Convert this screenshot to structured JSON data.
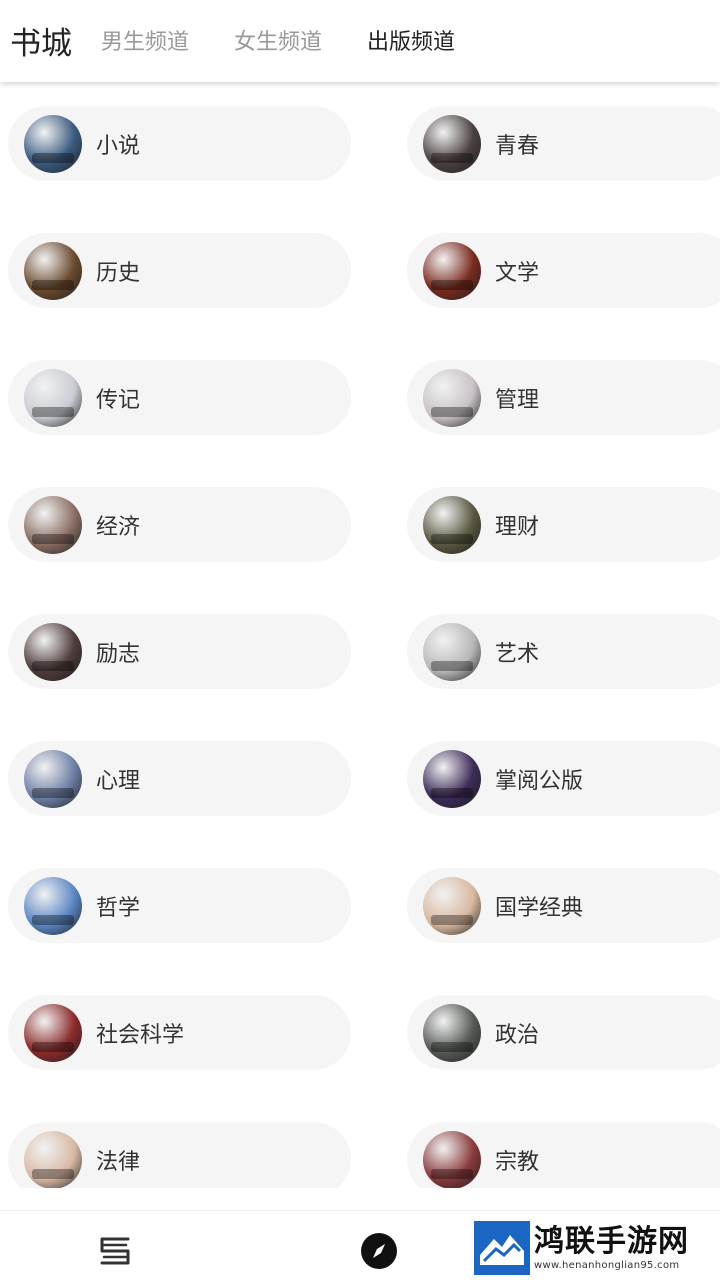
{
  "header": {
    "title": "书城",
    "tabs": [
      {
        "label": "男生频道",
        "active": false
      },
      {
        "label": "女生频道",
        "active": false
      },
      {
        "label": "出版频道",
        "active": true
      }
    ]
  },
  "categories": {
    "left": [
      {
        "label": "小说",
        "cover_color": "#3a5a80"
      },
      {
        "label": "历史",
        "cover_color": "#6b4a2e"
      },
      {
        "label": "传记",
        "cover_color": "#c9ccd2"
      },
      {
        "label": "经济",
        "cover_color": "#8a6e63"
      },
      {
        "label": "励志",
        "cover_color": "#4e3b3b"
      },
      {
        "label": "心理",
        "cover_color": "#6d7fa6"
      },
      {
        "label": "哲学",
        "cover_color": "#5a86c4"
      },
      {
        "label": "社会科学",
        "cover_color": "#8c2a2a"
      },
      {
        "label": "法律",
        "cover_color": "#d9b9a4"
      }
    ],
    "right": [
      {
        "label": "青春",
        "cover_color": "#4a4040"
      },
      {
        "label": "文学",
        "cover_color": "#7a2a1e"
      },
      {
        "label": "管理",
        "cover_color": "#c8c2c6"
      },
      {
        "label": "理财",
        "cover_color": "#5a5840"
      },
      {
        "label": "艺术",
        "cover_color": "#b8b8b8"
      },
      {
        "label": "掌阅公版",
        "cover_color": "#3c2a58"
      },
      {
        "label": "国学经典",
        "cover_color": "#d8b8a0"
      },
      {
        "label": "政治",
        "cover_color": "#555a55"
      },
      {
        "label": "宗教",
        "cover_color": "#8a3a3a"
      }
    ]
  },
  "bottom_nav": {
    "items": [
      {
        "icon": "bookshelf-icon"
      },
      {
        "icon": "compass-icon",
        "active": true
      }
    ]
  },
  "watermark": {
    "name": "鸿联手游网",
    "url": "www.henanhonglian95.com"
  }
}
